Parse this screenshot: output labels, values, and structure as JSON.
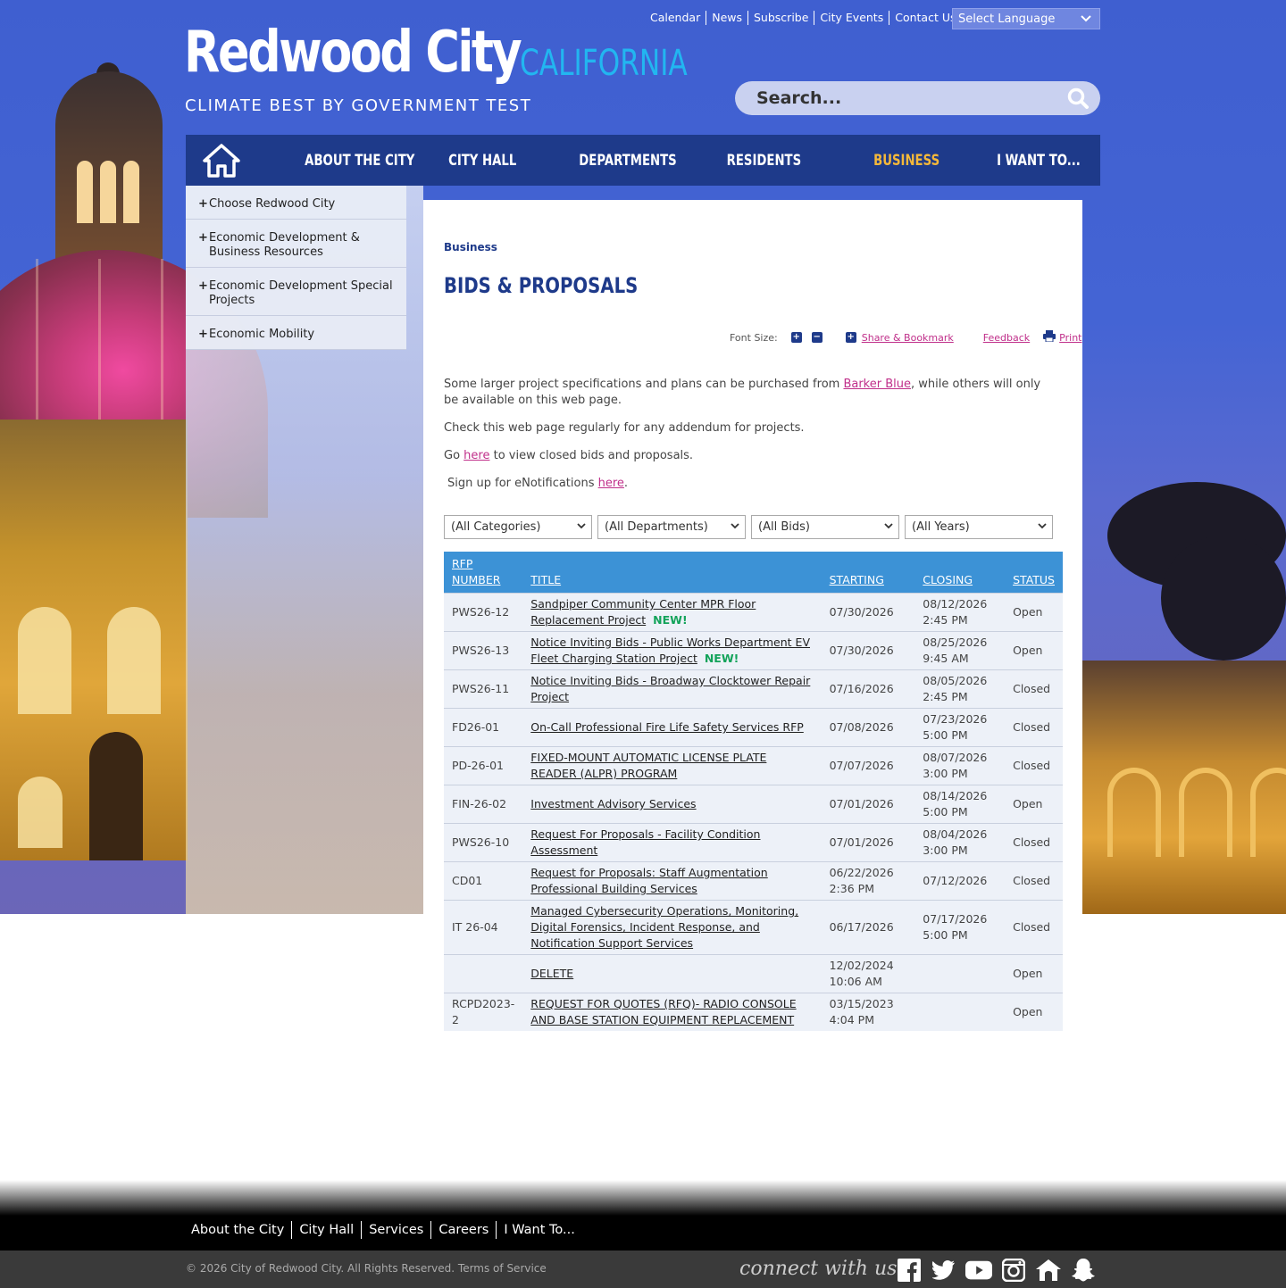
{
  "utility_links": [
    "Calendar",
    "News",
    "Subscribe",
    "City Events",
    "Contact Us"
  ],
  "language_select": "Select Language",
  "logo": {
    "name": "Redwood City",
    "state": "CALIFORNIA",
    "tagline": "CLIMATE BEST BY GOVERNMENT TEST"
  },
  "search": {
    "placeholder": "Search..."
  },
  "nav": {
    "items": [
      {
        "label": "ABOUT THE CITY",
        "active": false
      },
      {
        "label": "CITY HALL",
        "active": false
      },
      {
        "label": "DEPARTMENTS",
        "active": false
      },
      {
        "label": "RESIDENTS",
        "active": false
      },
      {
        "label": "BUSINESS",
        "active": true
      },
      {
        "label": "I WANT TO...",
        "active": false
      }
    ]
  },
  "sidebar": {
    "items": [
      "Choose Redwood City",
      "Economic Development & Business Resources",
      "Economic Development Special Projects",
      "Economic Mobility"
    ]
  },
  "page": {
    "breadcrumb": "Business",
    "title": "BIDS & PROPOSALS",
    "tools": {
      "font_size": "Font Size:",
      "share": "Share & Bookmark",
      "feedback": "Feedback",
      "print": "Print"
    },
    "intro_before": "Some larger project specifications and plans can be purchased from ",
    "intro_link": "Barker Blue",
    "intro_after": ", while others will only be available on this web page.",
    "check_text": "Check this web page regularly for any addendum for projects.",
    "closed_before": "Go ",
    "closed_link": "here",
    "closed_after": " to view closed bids and proposals.",
    "notify_before": "Sign up for eNotifications ",
    "notify_link": "here",
    "notify_after": ".",
    "filters": [
      "(All Categories)",
      "(All Departments)",
      "(All Bids)",
      "(All Years)"
    ]
  },
  "table": {
    "headers": [
      "RFP NUMBER",
      "TITLE",
      "STARTING",
      "CLOSING",
      "STATUS"
    ],
    "new_label": "NEW!",
    "rows": [
      {
        "rfp": "PWS26-12",
        "title": "Sandpiper Community Center MPR Floor Replacement Project",
        "is_new": true,
        "starting": "07/30/2026",
        "closing": "08/12/2026 2:45 PM",
        "status": "Open"
      },
      {
        "rfp": "PWS26-13",
        "title": "Notice Inviting Bids - Public Works Department EV Fleet Charging Station Project",
        "is_new": true,
        "starting": "07/30/2026",
        "closing": "08/25/2026 9:45 AM",
        "status": "Open"
      },
      {
        "rfp": "PWS26-11",
        "title": "Notice Inviting Bids - Broadway Clocktower Repair Project",
        "is_new": false,
        "starting": "07/16/2026",
        "closing": "08/05/2026 2:45 PM",
        "status": "Closed"
      },
      {
        "rfp": "FD26-01",
        "title": "On-Call Professional Fire Life Safety Services RFP",
        "is_new": false,
        "starting": "07/08/2026",
        "closing": "07/23/2026 5:00 PM",
        "status": "Closed"
      },
      {
        "rfp": "PD-26-01",
        "title": "FIXED-MOUNT AUTOMATIC LICENSE PLATE READER (ALPR) PROGRAM",
        "is_new": false,
        "starting": "07/07/2026",
        "closing": "08/07/2026 3:00 PM",
        "status": "Closed"
      },
      {
        "rfp": "FIN-26-02",
        "title": "Investment Advisory Services",
        "is_new": false,
        "starting": "07/01/2026",
        "closing": "08/14/2026 5:00 PM",
        "status": "Open"
      },
      {
        "rfp": "PWS26-10",
        "title": "Request For Proposals - Facility Condition Assessment",
        "is_new": false,
        "starting": "07/01/2026",
        "closing": "08/04/2026 3:00 PM",
        "status": "Closed"
      },
      {
        "rfp": "CD01",
        "title": "Request for Proposals: Staff Augmentation Professional Building Services",
        "is_new": false,
        "starting": "06/22/2026 2:36 PM",
        "closing": "07/12/2026",
        "status": "Closed"
      },
      {
        "rfp": "IT 26-04",
        "title": "Managed Cybersecurity Operations, Monitoring, Digital Forensics, Incident Response, and Notification Support Services",
        "is_new": false,
        "starting": "06/17/2026",
        "closing": "07/17/2026 5:00 PM",
        "status": "Closed"
      },
      {
        "rfp": "",
        "title": "DELETE",
        "is_new": false,
        "starting": "12/02/2024 10:06 AM",
        "closing": "",
        "status": "Open"
      },
      {
        "rfp": "RCPD2023-2",
        "title": "REQUEST FOR QUOTES (RFQ)- RADIO CONSOLE AND BASE STATION EQUIPMENT REPLACEMENT",
        "is_new": false,
        "starting": "03/15/2023 4:04 PM",
        "closing": "",
        "status": "Open"
      }
    ]
  },
  "footer": {
    "links": [
      "About the City",
      "City Hall",
      "Services",
      "Careers",
      "I Want To..."
    ],
    "copyright": "© 2026 City of Redwood City. All Rights Reserved.",
    "terms": "Terms of Service",
    "connect": "connect with us",
    "social": [
      "facebook-icon",
      "twitter-icon",
      "youtube-icon",
      "instagram-icon",
      "nextdoor-icon",
      "snapchat-icon"
    ]
  },
  "colors": {
    "nav_bg": "#1e3a8a",
    "accent": "#f5b83a",
    "link": "#c02f8a",
    "table_header": "#3c92d6",
    "new_badge": "#13a35a"
  }
}
